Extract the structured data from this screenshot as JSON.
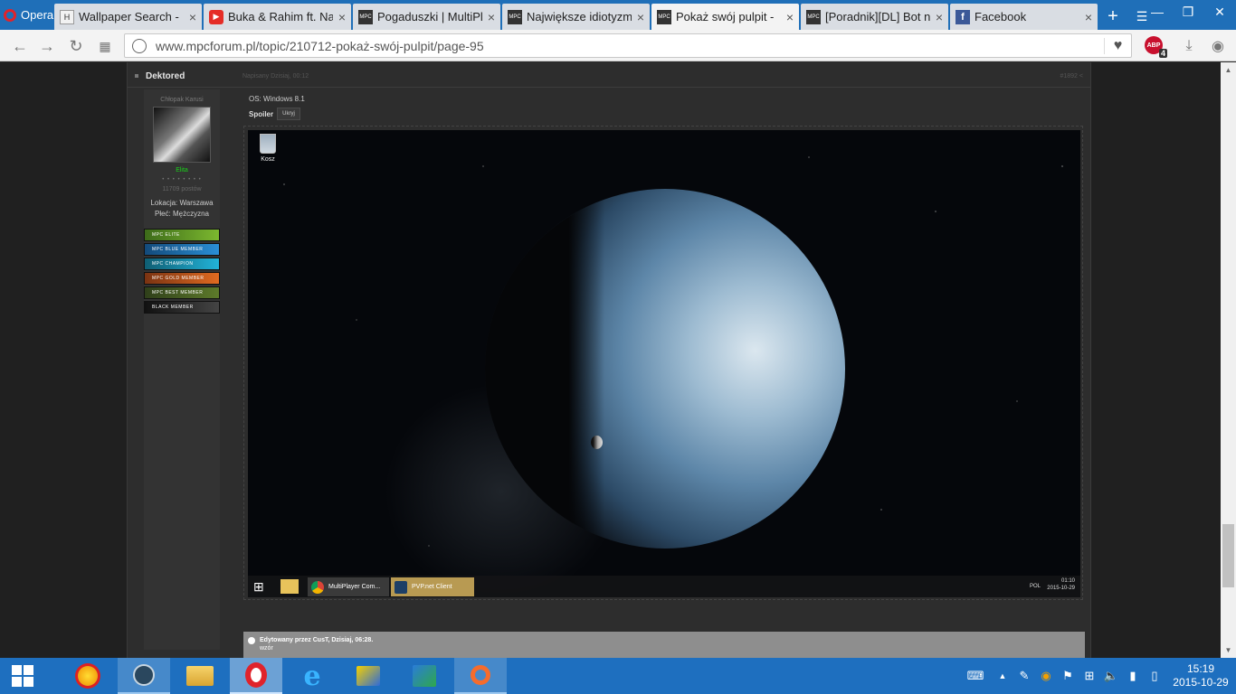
{
  "browser": {
    "menu_label": "Opera",
    "tabs": [
      {
        "title": "Wallpaper Search - ",
        "icon": "h-favicon"
      },
      {
        "title": "Buka & Rahim ft. Na",
        "icon": "youtube-favicon"
      },
      {
        "title": "Pogaduszki | MultiPl",
        "icon": "mpc-favicon"
      },
      {
        "title": "Największe idiotyzm",
        "icon": "mpc-favicon"
      },
      {
        "title": "Pokaż swój pulpit - ",
        "icon": "mpc-favicon",
        "active": true
      },
      {
        "title": "[Poradnik][DL] Bot n",
        "icon": "mpc-favicon"
      },
      {
        "title": "Facebook",
        "icon": "facebook-favicon"
      }
    ],
    "tab_close_glyph": "×",
    "new_tab_glyph": "+",
    "url": "www.mpcforum.pl/topic/210712-pokaż-swój-pulpit/page-95",
    "abp_label": "ABP",
    "abp_count": "4"
  },
  "post": {
    "author": "Dektored",
    "date": "Napisany Dzisiaj, 00:12",
    "number": "#1892",
    "user": {
      "rank": "Chłopak Karusi",
      "group": "Elita",
      "pips": "• • • • • • • •",
      "posts": "11709 postów",
      "location": "Lokacja: Warszawa",
      "gender": "Płeć: Mężczyzna",
      "badges": [
        "MPC ELITE",
        "MPC BLUE MEMBER",
        "MPC CHAMPION",
        "MPC GOLD MEMBER",
        "MPC BEST MEMBER",
        "BLACK MEMBER"
      ]
    },
    "os": "OS: Windows 8.1",
    "spoiler_label": "Spoiler",
    "spoiler_button": "Ukryj",
    "screenshot": {
      "recycle_label": "Kosz",
      "taskbar_apps": [
        "MultiPlayer Com...",
        "PVP.net Client"
      ],
      "lang": "POL",
      "time": "01:10",
      "date": "2015-10-29"
    },
    "edit_note": "Edytowany przez CusT, Dzisiaj, 06:28.",
    "edit_reason": "wzór"
  },
  "taskbar": {
    "lang_indicator": "",
    "time": "15:19",
    "date": "2015-10-29"
  },
  "colors": {
    "tabbar": "#1f6fb8",
    "taskbar": "#1e6fbf",
    "elite_group": "#19d419",
    "opera_red": "#e0232b"
  }
}
